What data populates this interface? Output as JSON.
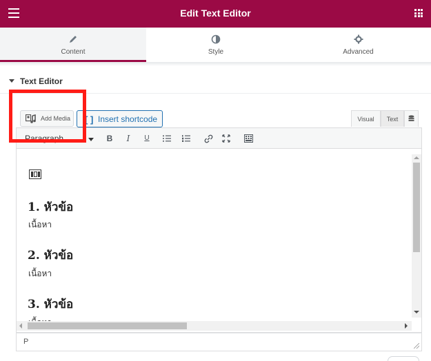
{
  "header": {
    "title": "Edit Text Editor",
    "menu_icon": "hamburger-icon",
    "grid_icon": "apps-grid-icon",
    "background_color": "#9b0a45"
  },
  "tabs": [
    {
      "label": "Content",
      "icon": "pencil-icon",
      "active": true
    },
    {
      "label": "Style",
      "icon": "contrast-icon",
      "active": false
    },
    {
      "label": "Advanced",
      "icon": "gear-icon",
      "active": false
    }
  ],
  "section": {
    "title": "Text Editor"
  },
  "editor_buttons": {
    "add_media": "Add Media",
    "insert_shortcode": "Insert shortcode",
    "shortcode_icon": "[ ]",
    "mode_visual": "Visual",
    "mode_text": "Text"
  },
  "toolbar": {
    "format_select": "Paragraph",
    "items": [
      "bold-icon",
      "italic-icon",
      "underline-icon",
      "bullet-list-icon",
      "numbered-list-icon",
      "link-icon",
      "fullscreen-icon",
      "toolbar-toggle-icon"
    ]
  },
  "content": {
    "blocks": [
      {
        "heading": "1. หัวข้อ",
        "body": "เนื้อหา"
      },
      {
        "heading": "2. หัวข้อ",
        "body": "เนื้อหา"
      },
      {
        "heading": "3. หัวข้อ",
        "body": "เนื้อหา"
      }
    ]
  },
  "statusbar": {
    "path": "P"
  },
  "highlight_color": "#ff1c16",
  "link_color": "#2271b1"
}
